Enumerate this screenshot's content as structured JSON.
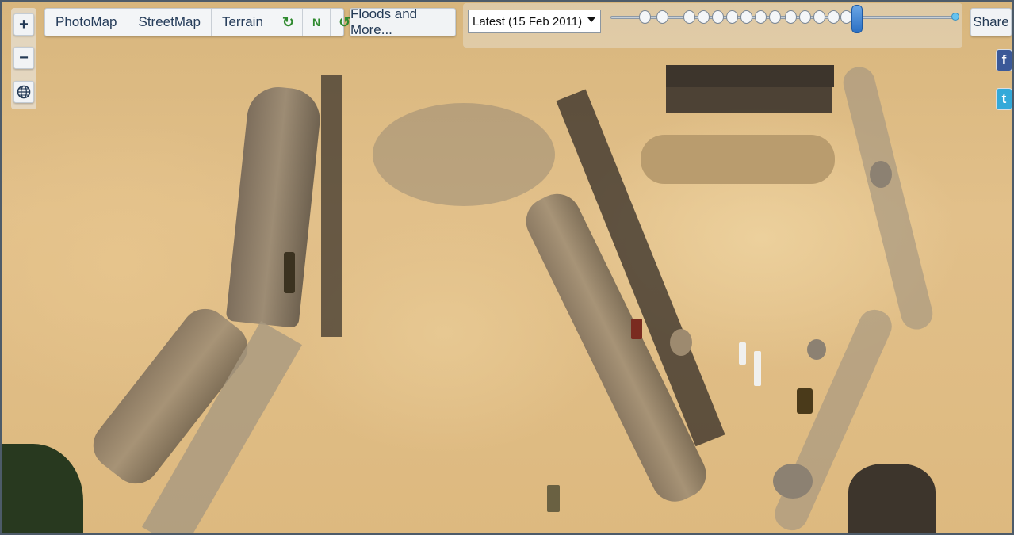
{
  "zoom": {
    "in_label": "+",
    "out_label": "−"
  },
  "map_types": {
    "photomap": "PhotoMap",
    "streetmap": "StreetMap",
    "terrain": "Terrain",
    "rotate_left": "↻",
    "north": "N",
    "rotate_right": "↺"
  },
  "floods_button": "Floods and More...",
  "date_select": {
    "selected": "Latest (15 Feb 2011)"
  },
  "timeline": {
    "tick_count": 21,
    "current_value": 0.71
  },
  "share_button": "Share",
  "social": {
    "facebook": "f",
    "twitter": "t"
  },
  "colors": {
    "toolbar_text": "#253c5a",
    "rotate_green": "#2f8a2f",
    "slider_thumb": "#2a6fc3",
    "facebook": "#3b5998",
    "twitter": "#33a9d9"
  },
  "icons": [
    "globe-icon",
    "rotate-left-icon",
    "rotate-right-icon",
    "facebook-icon",
    "twitter-icon",
    "dropdown-arrow-icon"
  ]
}
